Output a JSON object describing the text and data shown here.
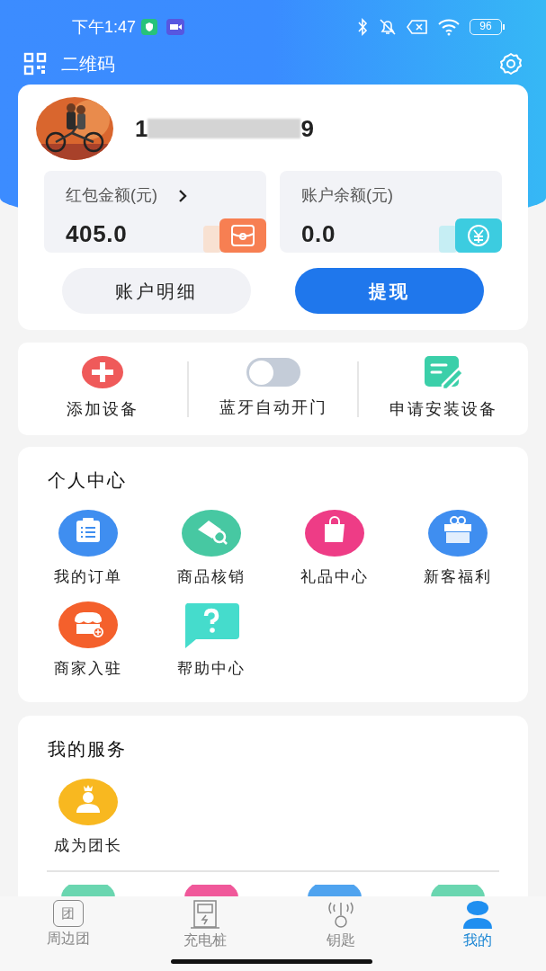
{
  "status_bar": {
    "time": "下午1:47",
    "battery": "96"
  },
  "header": {
    "qr_label": "二维码"
  },
  "profile": {
    "phone_start": "1",
    "phone_end": "9"
  },
  "balances": [
    {
      "label": "红包金额(元)",
      "value": "405.0",
      "has_arrow": true,
      "kind": "redpacket"
    },
    {
      "label": "账户余额(元)",
      "value": "0.0",
      "has_arrow": false,
      "kind": "yuan"
    }
  ],
  "actions": [
    {
      "label": "账户明细",
      "primary": false
    },
    {
      "label": "提现",
      "primary": true
    }
  ],
  "quick": [
    {
      "kind": "add",
      "label": "添加设备"
    },
    {
      "kind": "toggle",
      "label": "蓝牙自动开门",
      "on": false
    },
    {
      "kind": "apply",
      "label": "申请安装设备"
    }
  ],
  "personal_center": {
    "title": "个人中心",
    "items": [
      {
        "kind": "order",
        "label": "我的订单"
      },
      {
        "kind": "verify",
        "label": "商品核销"
      },
      {
        "kind": "gift_bag",
        "label": "礼品中心"
      },
      {
        "kind": "gift",
        "label": "新客福利"
      },
      {
        "kind": "shop",
        "label": "商家入驻"
      },
      {
        "kind": "help",
        "label": "帮助中心"
      }
    ]
  },
  "my_services": {
    "title": "我的服务",
    "items": [
      {
        "kind": "leader",
        "label": "成为团长"
      }
    ]
  },
  "tab_bar": [
    {
      "kind": "group",
      "label": "周边团",
      "icon_text": "团",
      "selected": false
    },
    {
      "kind": "charger",
      "label": "充电桩",
      "selected": false
    },
    {
      "kind": "key",
      "label": "钥匙",
      "selected": false
    },
    {
      "kind": "me",
      "label": "我的",
      "selected": true
    }
  ]
}
